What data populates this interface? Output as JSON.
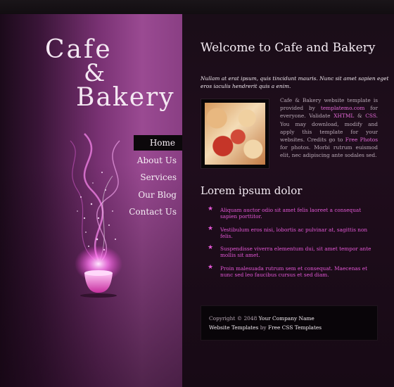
{
  "logo": {
    "line1": "Cafe",
    "line2": "&",
    "line3": "Bakery"
  },
  "nav": [
    "Home",
    "About Us",
    "Services",
    "Our Blog",
    "Contact Us"
  ],
  "main": {
    "title": "Welcome to Cafe and Bakery",
    "intro": "Nullam at erat ipsum, quis tincidunt mauris. Nunc sit amet sapien eget eros iaculis hendrerit quis a enim.",
    "body": {
      "p1": "Cafe & Bakery website template is provided by",
      "link1": "templatemo.com",
      "p2": "for everyone. Validate",
      "link2": "XHTML",
      "p3": "&",
      "link3": "CSS",
      "p4": ". You may download, modify and apply this template for your websites. Credits go to",
      "link4": "Free Photos",
      "p5": "for photos. Morbi rutrum euismod elit, nec adipiscing ante sodales sed."
    },
    "subheading": "Lorem ipsum dolor",
    "list": [
      "Aliquam auctor odio sit amet felis laoreet a consequat sapien porttitor.",
      "Vestibulum eros nisi, lobortis ac pulvinar at, sagittis non felis.",
      "Suspendisse viverra elementum dui, sit amet tempor ante mollis sit amet.",
      "Proin malesuada rutrum sem et consequat. Maecenas et nunc sed leo faucibus cursus et sed diam."
    ]
  },
  "footer": {
    "copyright": "Copyright © 2048",
    "company": "Your Company Name",
    "templates_label": "Website Templates",
    "by": "by",
    "templates_source": "Free CSS Templates"
  },
  "colors": {
    "accent": "#e457d6",
    "panel": "#9a4a92"
  }
}
